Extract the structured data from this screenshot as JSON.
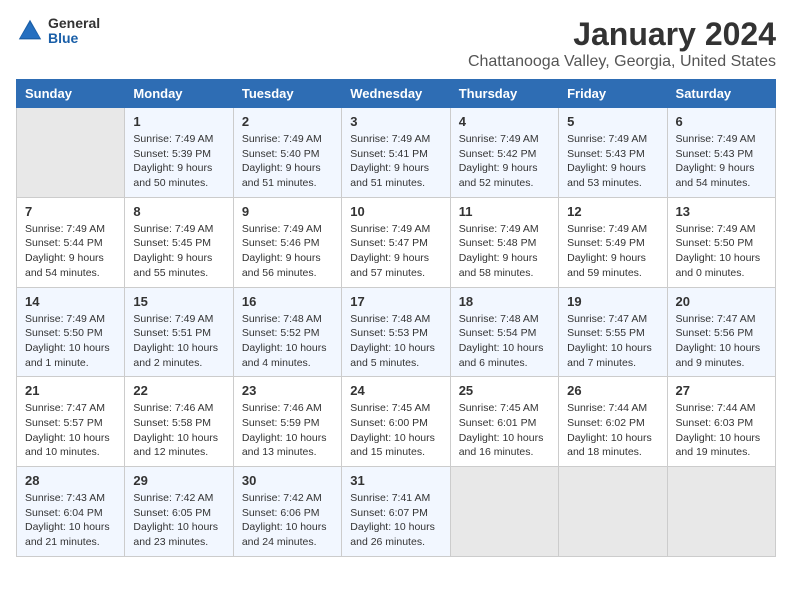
{
  "header": {
    "logo_general": "General",
    "logo_blue": "Blue",
    "month_title": "January 2024",
    "location": "Chattanooga Valley, Georgia, United States"
  },
  "days_of_week": [
    "Sunday",
    "Monday",
    "Tuesday",
    "Wednesday",
    "Thursday",
    "Friday",
    "Saturday"
  ],
  "weeks": [
    [
      {
        "day": "",
        "info": ""
      },
      {
        "day": "1",
        "info": "Sunrise: 7:49 AM\nSunset: 5:39 PM\nDaylight: 9 hours\nand 50 minutes."
      },
      {
        "day": "2",
        "info": "Sunrise: 7:49 AM\nSunset: 5:40 PM\nDaylight: 9 hours\nand 51 minutes."
      },
      {
        "day": "3",
        "info": "Sunrise: 7:49 AM\nSunset: 5:41 PM\nDaylight: 9 hours\nand 51 minutes."
      },
      {
        "day": "4",
        "info": "Sunrise: 7:49 AM\nSunset: 5:42 PM\nDaylight: 9 hours\nand 52 minutes."
      },
      {
        "day": "5",
        "info": "Sunrise: 7:49 AM\nSunset: 5:43 PM\nDaylight: 9 hours\nand 53 minutes."
      },
      {
        "day": "6",
        "info": "Sunrise: 7:49 AM\nSunset: 5:43 PM\nDaylight: 9 hours\nand 54 minutes."
      }
    ],
    [
      {
        "day": "7",
        "info": "Sunrise: 7:49 AM\nSunset: 5:44 PM\nDaylight: 9 hours\nand 54 minutes."
      },
      {
        "day": "8",
        "info": "Sunrise: 7:49 AM\nSunset: 5:45 PM\nDaylight: 9 hours\nand 55 minutes."
      },
      {
        "day": "9",
        "info": "Sunrise: 7:49 AM\nSunset: 5:46 PM\nDaylight: 9 hours\nand 56 minutes."
      },
      {
        "day": "10",
        "info": "Sunrise: 7:49 AM\nSunset: 5:47 PM\nDaylight: 9 hours\nand 57 minutes."
      },
      {
        "day": "11",
        "info": "Sunrise: 7:49 AM\nSunset: 5:48 PM\nDaylight: 9 hours\nand 58 minutes."
      },
      {
        "day": "12",
        "info": "Sunrise: 7:49 AM\nSunset: 5:49 PM\nDaylight: 9 hours\nand 59 minutes."
      },
      {
        "day": "13",
        "info": "Sunrise: 7:49 AM\nSunset: 5:50 PM\nDaylight: 10 hours\nand 0 minutes."
      }
    ],
    [
      {
        "day": "14",
        "info": "Sunrise: 7:49 AM\nSunset: 5:50 PM\nDaylight: 10 hours\nand 1 minute."
      },
      {
        "day": "15",
        "info": "Sunrise: 7:49 AM\nSunset: 5:51 PM\nDaylight: 10 hours\nand 2 minutes."
      },
      {
        "day": "16",
        "info": "Sunrise: 7:48 AM\nSunset: 5:52 PM\nDaylight: 10 hours\nand 4 minutes."
      },
      {
        "day": "17",
        "info": "Sunrise: 7:48 AM\nSunset: 5:53 PM\nDaylight: 10 hours\nand 5 minutes."
      },
      {
        "day": "18",
        "info": "Sunrise: 7:48 AM\nSunset: 5:54 PM\nDaylight: 10 hours\nand 6 minutes."
      },
      {
        "day": "19",
        "info": "Sunrise: 7:47 AM\nSunset: 5:55 PM\nDaylight: 10 hours\nand 7 minutes."
      },
      {
        "day": "20",
        "info": "Sunrise: 7:47 AM\nSunset: 5:56 PM\nDaylight: 10 hours\nand 9 minutes."
      }
    ],
    [
      {
        "day": "21",
        "info": "Sunrise: 7:47 AM\nSunset: 5:57 PM\nDaylight: 10 hours\nand 10 minutes."
      },
      {
        "day": "22",
        "info": "Sunrise: 7:46 AM\nSunset: 5:58 PM\nDaylight: 10 hours\nand 12 minutes."
      },
      {
        "day": "23",
        "info": "Sunrise: 7:46 AM\nSunset: 5:59 PM\nDaylight: 10 hours\nand 13 minutes."
      },
      {
        "day": "24",
        "info": "Sunrise: 7:45 AM\nSunset: 6:00 PM\nDaylight: 10 hours\nand 15 minutes."
      },
      {
        "day": "25",
        "info": "Sunrise: 7:45 AM\nSunset: 6:01 PM\nDaylight: 10 hours\nand 16 minutes."
      },
      {
        "day": "26",
        "info": "Sunrise: 7:44 AM\nSunset: 6:02 PM\nDaylight: 10 hours\nand 18 minutes."
      },
      {
        "day": "27",
        "info": "Sunrise: 7:44 AM\nSunset: 6:03 PM\nDaylight: 10 hours\nand 19 minutes."
      }
    ],
    [
      {
        "day": "28",
        "info": "Sunrise: 7:43 AM\nSunset: 6:04 PM\nDaylight: 10 hours\nand 21 minutes."
      },
      {
        "day": "29",
        "info": "Sunrise: 7:42 AM\nSunset: 6:05 PM\nDaylight: 10 hours\nand 23 minutes."
      },
      {
        "day": "30",
        "info": "Sunrise: 7:42 AM\nSunset: 6:06 PM\nDaylight: 10 hours\nand 24 minutes."
      },
      {
        "day": "31",
        "info": "Sunrise: 7:41 AM\nSunset: 6:07 PM\nDaylight: 10 hours\nand 26 minutes."
      },
      {
        "day": "",
        "info": ""
      },
      {
        "day": "",
        "info": ""
      },
      {
        "day": "",
        "info": ""
      }
    ]
  ]
}
